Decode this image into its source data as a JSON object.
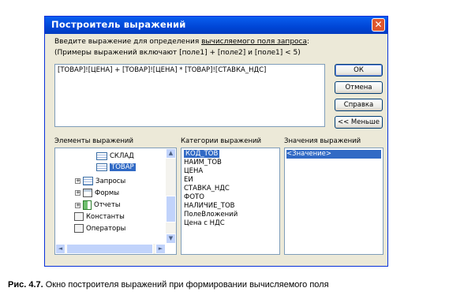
{
  "window": {
    "title": "Построитель выражений",
    "close_glyph": "✕"
  },
  "prompt": {
    "line1_prefix": "Введите выражение для определения ",
    "line1_link": "вычисляемого поля запроса",
    "line1_suffix": ":",
    "line2": "(Примеры выражений включают [поле1] + [поле2] и [поле1] < 5)"
  },
  "expression": {
    "value": "[ТОВАР]![ЦЕНА] + [ТОВАР]![ЦЕНА] * [ТОВАР]![СТАВКА_НДС]"
  },
  "buttons": {
    "ok": "ОК",
    "cancel": "Отмена",
    "help": "Справка",
    "less": "<< Меньше"
  },
  "labels": {
    "elements": "Элементы выражений",
    "categories": "Категории выражений",
    "values": "Значения выражений"
  },
  "tree": {
    "items": [
      {
        "label": "СКЛАД",
        "icon": "table-icon"
      },
      {
        "label": "ТОВАР",
        "icon": "table-icon",
        "selected": true
      },
      {
        "label": "Запросы",
        "icon": "query-icon",
        "expander": "+"
      },
      {
        "label": "Формы",
        "icon": "form-icon",
        "expander": "+"
      },
      {
        "label": "Отчеты",
        "icon": "report-icon",
        "expander": "+"
      },
      {
        "label": "Константы",
        "icon": "folder-icon"
      },
      {
        "label": "Операторы",
        "icon": "folder-icon"
      }
    ]
  },
  "categories": {
    "items": [
      "КОД_ТОВ",
      "НАИМ_ТОВ",
      "ЦЕНА",
      "ЕИ",
      "СТАВКА_НДС",
      "ФОТО",
      "НАЛИЧИЕ_ТОВ",
      "ПолеВложений",
      "Цена с НДС"
    ],
    "selected_index": 0
  },
  "values": {
    "items": [
      "<Значение>"
    ],
    "selected_index": 0
  },
  "scroll": {
    "up": "▲",
    "down": "▼",
    "left": "◄",
    "right": "►"
  },
  "caption": {
    "bold": "Рис. 4.7.",
    "text": " Окно построителя выражений при формировании вычисляемого поля"
  },
  "colors": {
    "title_bar": "#0054e3",
    "selection": "#316ac5",
    "dialog_bg": "#ece9d8"
  }
}
